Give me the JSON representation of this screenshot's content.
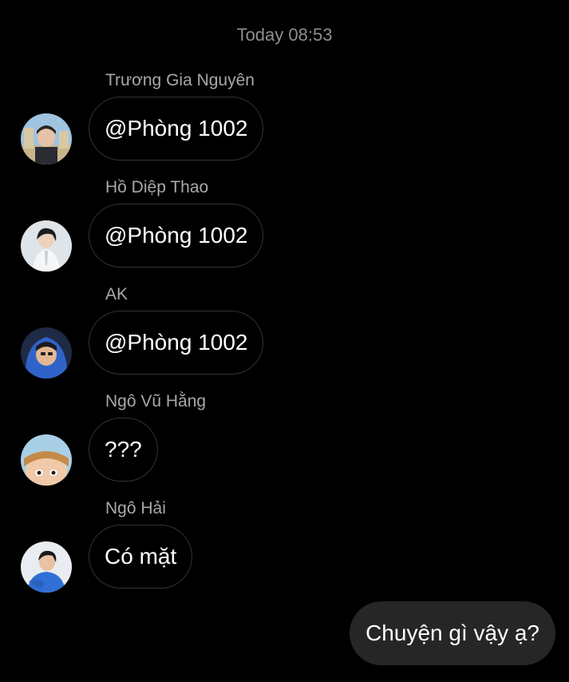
{
  "timestamp": "Today 08:53",
  "messages": [
    {
      "sender": "Trương Gia Nguyên",
      "text": "@Phòng 1002",
      "avatar_icon": "avatar-photo"
    },
    {
      "sender": "Hồ Diệp Thao",
      "text": "@Phòng 1002",
      "avatar_icon": "avatar-photo"
    },
    {
      "sender": "AK",
      "text": "@Phòng 1002",
      "avatar_icon": "avatar-photo"
    },
    {
      "sender": "Ngô Vũ Hằng",
      "text": "???",
      "avatar_icon": "avatar-photo"
    },
    {
      "sender": "Ngô Hải",
      "text": "Có mặt",
      "avatar_icon": "avatar-photo"
    }
  ],
  "own_message": {
    "text": "Chuyện gì vậy ạ?"
  },
  "colors": {
    "background": "#000000",
    "bubble_border": "#333333",
    "own_bubble": "#262626",
    "sender_text": "#a8a8a8",
    "timestamp_text": "#8e8e8e"
  }
}
